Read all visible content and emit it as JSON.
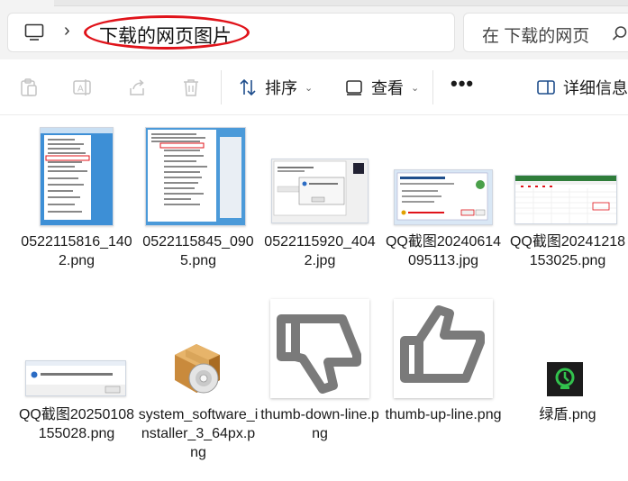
{
  "address": {
    "crumb_label": "下载的网页图片",
    "search_placeholder": "在 下载的网页"
  },
  "toolbar": {
    "sort_label": "排序",
    "view_label": "查看",
    "details_label": "详细信息",
    "more_label": "•••"
  },
  "files": [
    {
      "name": "0522115816_1402.png",
      "icon": "screenshot-thumbnail"
    },
    {
      "name": "0522115845_0905.png",
      "icon": "screenshot-thumbnail"
    },
    {
      "name": "0522115920_4042.jpg",
      "icon": "screenshot-thumbnail"
    },
    {
      "name": "QQ截图20240614095113.jpg",
      "icon": "screenshot-thumbnail"
    },
    {
      "name": "QQ截图20241218153025.png",
      "icon": "screenshot-thumbnail"
    },
    {
      "name": "QQ截图20250108155028.png",
      "icon": "screenshot-thumbnail"
    },
    {
      "name": "system_software_installer_3_64px.png",
      "icon": "installer-box-icon"
    },
    {
      "name": "thumb-down-line.png",
      "icon": "thumb-down-icon"
    },
    {
      "name": "thumb-up-line.png",
      "icon": "thumb-up-icon"
    },
    {
      "name": "绿盾.png",
      "icon": "green-shield-icon"
    }
  ],
  "colors": {
    "highlight_red": "#e0131a",
    "accent_blue": "#0067c0"
  }
}
